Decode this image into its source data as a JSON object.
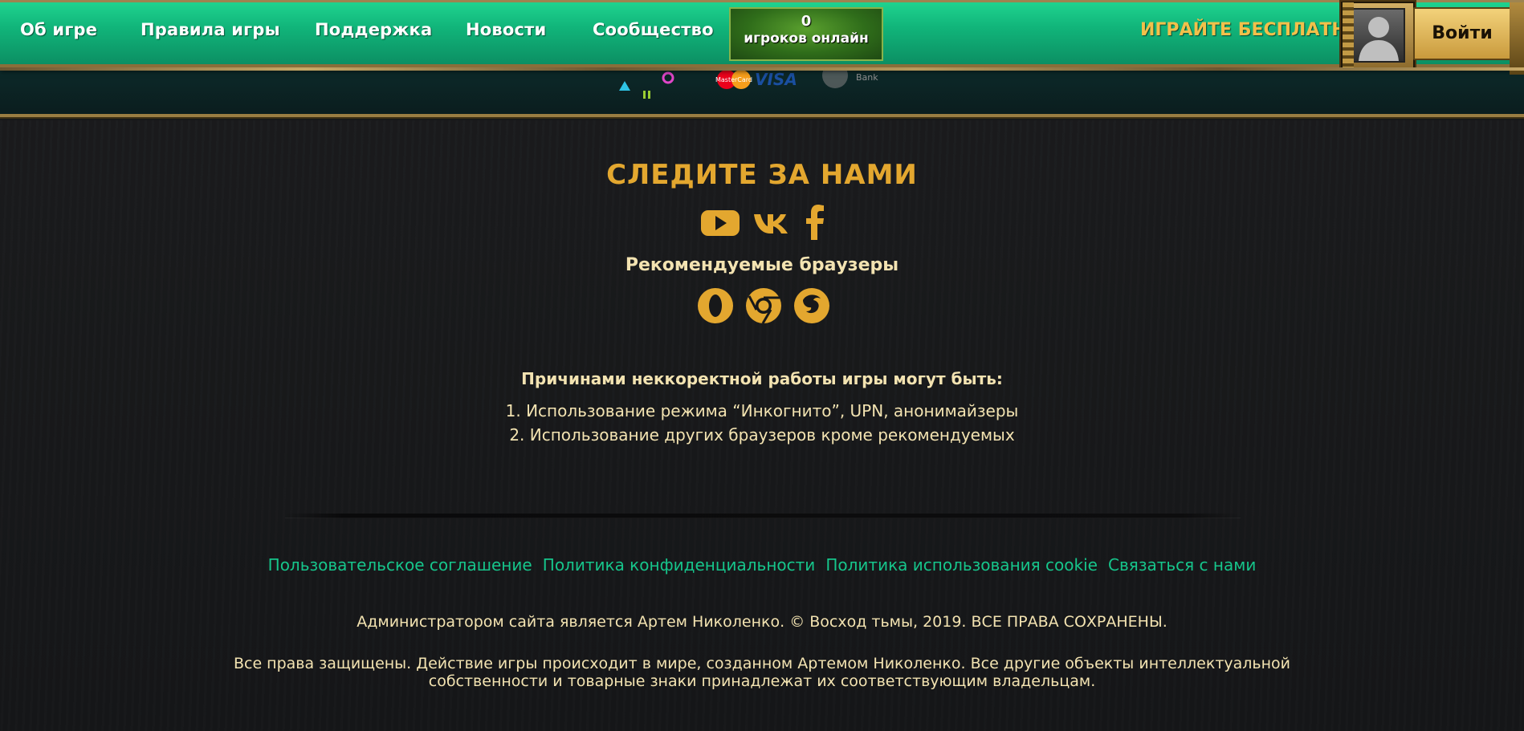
{
  "nav": {
    "items": [
      {
        "label": "Об игре"
      },
      {
        "label": "Правила игры"
      },
      {
        "label": "Поддержка"
      },
      {
        "label": "Новости"
      },
      {
        "label": "Сообщество"
      }
    ],
    "online_count": "0",
    "online_label": "игроков онлайн",
    "play_free": "ИГРАЙТЕ БЕСПЛАТНО!",
    "login": "Войти"
  },
  "payments": {
    "mastercard_text": "MasterCard",
    "visa_text": "VISA",
    "bank_text": "Bank"
  },
  "follow": {
    "title": "СЛЕДИТЕ ЗА НАМИ",
    "icons": [
      "youtube-icon",
      "vk-icon",
      "facebook-icon"
    ]
  },
  "browsers": {
    "title": "Рекомендуемые браузеры",
    "icons": [
      "opera-icon",
      "chrome-icon",
      "firefox-icon"
    ]
  },
  "reasons": {
    "title": "Причинами неккоректной работы игры могут быть:",
    "items": [
      "1. Использование режима “Инкогнито”, UPN, анонимайзеры",
      "2. Использование других браузеров кроме рекомендуемых"
    ]
  },
  "legal": {
    "links": [
      "Пользовательское соглашение",
      "Политика конфиденциальности",
      "Политика использования cookie",
      "Связаться с нами"
    ],
    "admin": "Администратором сайта является Артем Николенко. © Восход тьмы, 2019. ВСЕ ПРАВА СОХРАНЕНЫ.",
    "rights_1": "Все права защищены. Действие игры происходит в мире, созданном Артемом Николенко. Все другие объекты интеллектуальной",
    "rights_2": "собственности и товарные знаки принадлежат их соответствующим владельцам."
  },
  "colors": {
    "nav_green": "#11b57a",
    "gold": "#e3a72f",
    "cream_text": "#f3e3b1",
    "link_green": "#16c58b",
    "background": "#17181a"
  }
}
